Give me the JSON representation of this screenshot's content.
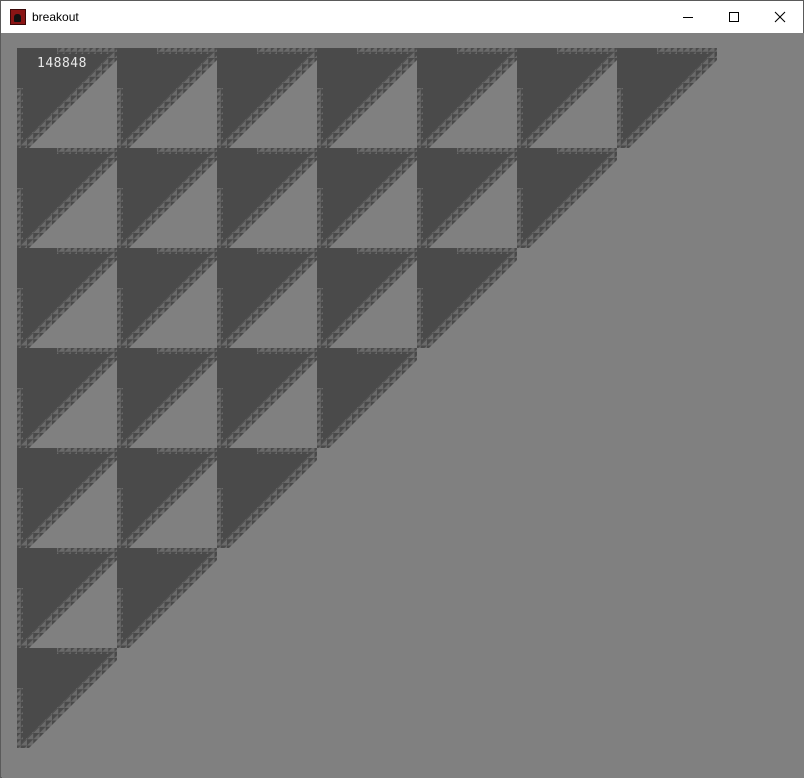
{
  "window": {
    "title": "breakout",
    "icon": "app-icon",
    "controls": [
      "minimize-icon",
      "maximize-icon",
      "close-icon"
    ]
  },
  "game": {
    "score": "148848",
    "colors": {
      "background": "#808080",
      "brick": "#4a4a4a",
      "score_text": "#e8e8e8"
    }
  }
}
